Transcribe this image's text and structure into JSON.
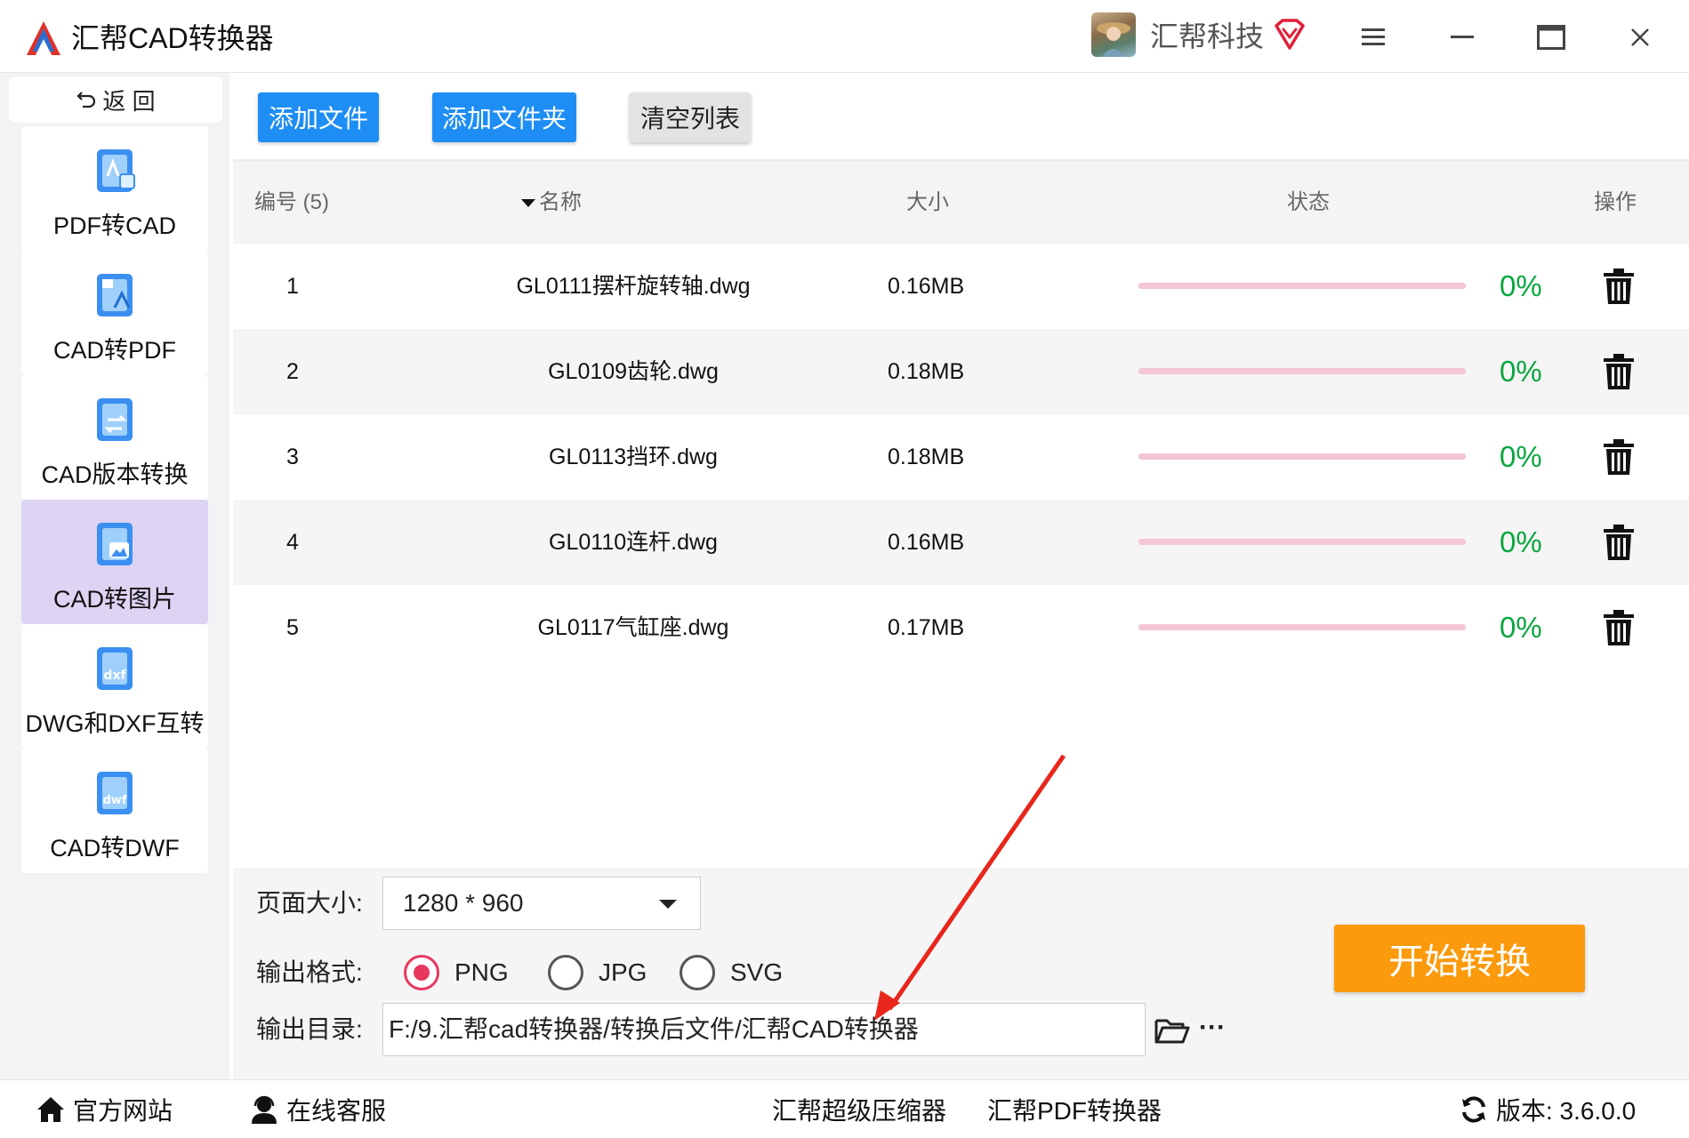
{
  "app": {
    "title": "汇帮CAD转换器"
  },
  "user": {
    "name": "汇帮科技"
  },
  "sidebar": {
    "back_label": "返 回",
    "items": [
      {
        "label": "PDF转CAD"
      },
      {
        "label": "CAD转PDF"
      },
      {
        "label": "CAD版本转换"
      },
      {
        "label": "CAD转图片",
        "active": true
      },
      {
        "label": "DWG和DXF互转"
      },
      {
        "label": "CAD转DWF"
      }
    ]
  },
  "toolbar": {
    "add_file": "添加文件",
    "add_folder": "添加文件夹",
    "clear_list": "清空列表"
  },
  "table": {
    "headers": {
      "index": "编号 (5)",
      "name": "名称",
      "size": "大小",
      "status": "状态",
      "action": "操作"
    },
    "rows": [
      {
        "index": "1",
        "name": "GL0111摆杆旋转轴.dwg",
        "size": "0.16MB",
        "progress": "0%"
      },
      {
        "index": "2",
        "name": "GL0109齿轮.dwg",
        "size": "0.18MB",
        "progress": "0%"
      },
      {
        "index": "3",
        "name": "GL0113挡环.dwg",
        "size": "0.18MB",
        "progress": "0%"
      },
      {
        "index": "4",
        "name": "GL0110连杆.dwg",
        "size": "0.16MB",
        "progress": "0%"
      },
      {
        "index": "5",
        "name": "GL0117气缸座.dwg",
        "size": "0.17MB",
        "progress": "0%"
      }
    ]
  },
  "settings": {
    "page_size_label": "页面大小:",
    "page_size_value": "1280 * 960",
    "format_label": "输出格式:",
    "formats": [
      {
        "label": "PNG",
        "checked": true
      },
      {
        "label": "JPG",
        "checked": false
      },
      {
        "label": "SVG",
        "checked": false
      }
    ],
    "output_dir_label": "输出目录:",
    "output_dir_value": "F:/9.汇帮cad转换器/转换后文件/汇帮CAD转换器",
    "more_label": "···",
    "start_label": "开始转换"
  },
  "statusbar": {
    "website": "官方网站",
    "support": "在线客服",
    "compressor": "汇帮超级压缩器",
    "pdf_converter": "汇帮PDF转换器",
    "version": "版本: 3.6.0.0"
  },
  "colors": {
    "primary": "#1e8ef5",
    "accent": "#fb9a0c",
    "success": "#0aa640",
    "radio": "#e8375f",
    "active_nav": "#ddd3f3",
    "arrow": "#e8261c"
  },
  "icons": {
    "window": [
      "menu-icon",
      "minimize-icon",
      "maximize-icon",
      "close-icon"
    ],
    "row_action": "trash-icon",
    "folder": "folder-open-icon",
    "home": "home-icon",
    "support": "headset-icon",
    "version": "refresh-icon"
  }
}
